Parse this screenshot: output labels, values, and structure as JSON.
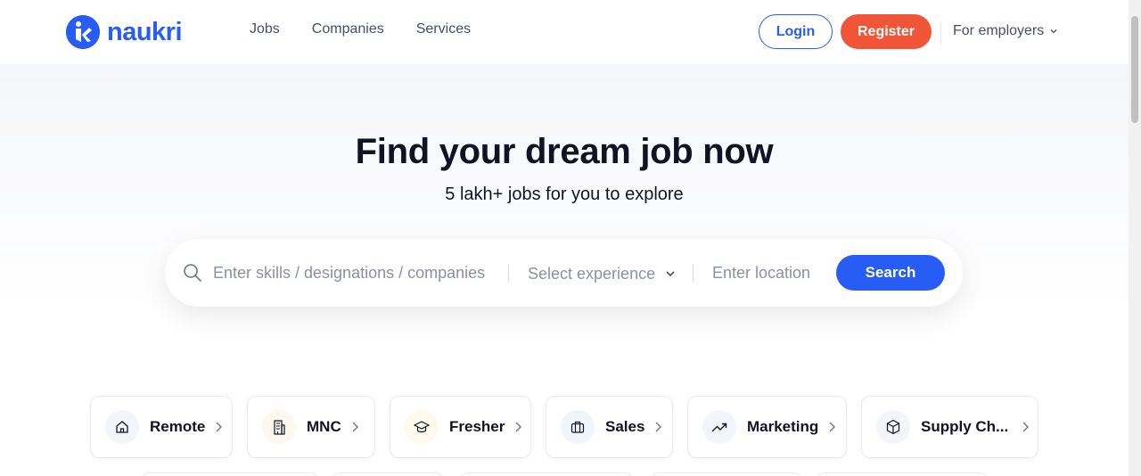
{
  "header": {
    "logo_text": "naukri",
    "nav": [
      {
        "label": "Jobs"
      },
      {
        "label": "Companies"
      },
      {
        "label": "Services"
      }
    ],
    "login_label": "Login",
    "register_label": "Register",
    "employers_label": "For employers"
  },
  "hero": {
    "title": "Find your dream job now",
    "subtitle": "5 lakh+ jobs for you to explore"
  },
  "search": {
    "skills_placeholder": "Enter skills / designations / companies",
    "experience_label": "Select experience",
    "location_placeholder": "Enter location",
    "button_label": "Search"
  },
  "categories": [
    {
      "label": "Remote",
      "icon": "home-icon"
    },
    {
      "label": "MNC",
      "icon": "building-icon"
    },
    {
      "label": "Fresher",
      "icon": "graduation-cap-icon"
    },
    {
      "label": "Sales",
      "icon": "briefcase-icon"
    },
    {
      "label": "Marketing",
      "icon": "trend-up-icon"
    },
    {
      "label": "Supply Ch...",
      "icon": "box-icon"
    }
  ],
  "colors": {
    "brand": "#275df5",
    "register": "#f05537",
    "text": "#121224"
  }
}
